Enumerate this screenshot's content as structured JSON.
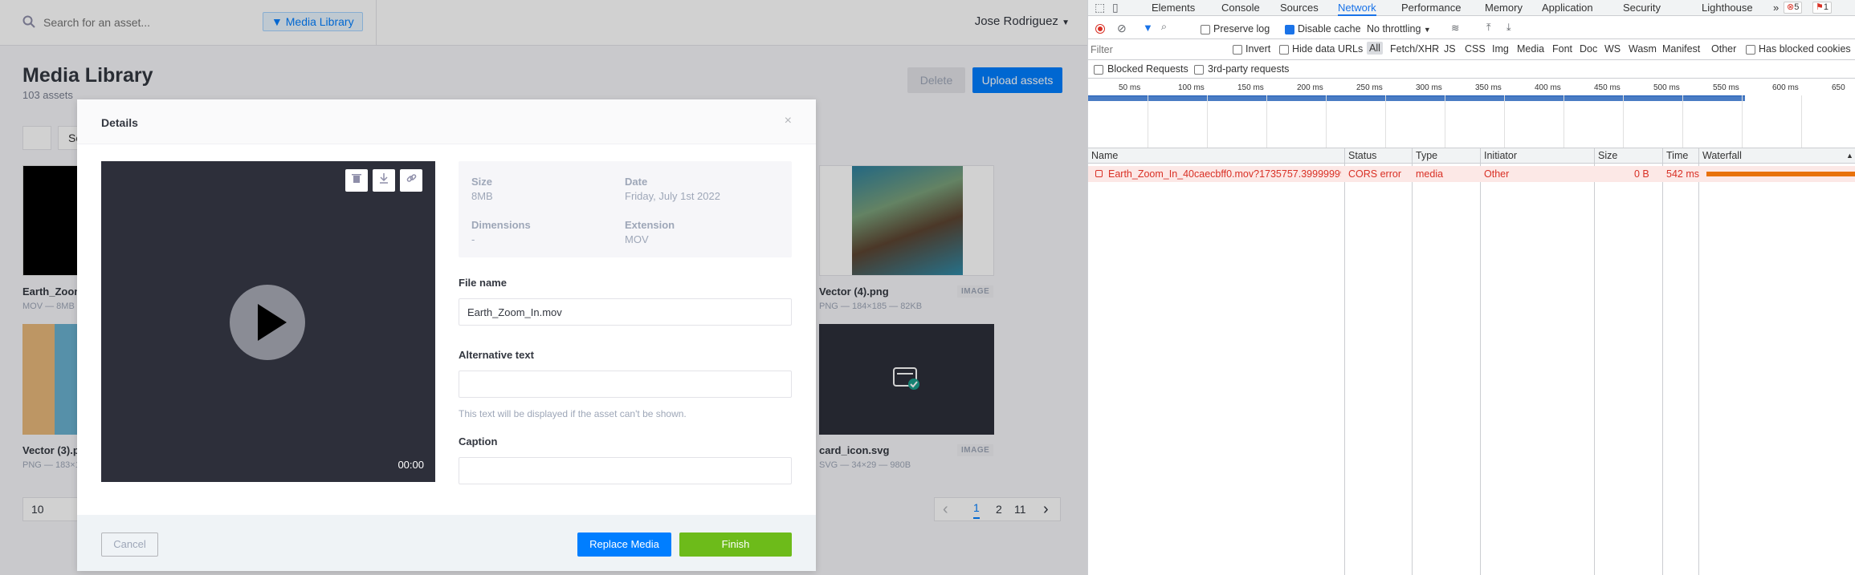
{
  "app": {
    "search": {
      "placeholder": "Search for an asset..."
    },
    "filter_chip": "Media Library",
    "user_name": "Jose Rodriguez",
    "title": "Media Library",
    "subtitle": "103 assets",
    "delete_label": "Delete",
    "upload_label": "Upload assets",
    "sort_partial": "So",
    "cards": [
      {
        "name": "Earth_Zoom",
        "meta": "MOV — 8MB"
      },
      {
        "name": "Vector (3).p",
        "meta": "PNG — 183×1"
      },
      {
        "name": "Vector (4).png",
        "meta": "PNG — 184×185 — 82KB",
        "tag": "IMAGE"
      },
      {
        "name": "card_icon.svg",
        "meta": "SVG — 34×29 — 980B",
        "tag": "IMAGE"
      }
    ],
    "page_size": "10",
    "pages": [
      "1",
      "2",
      "11"
    ],
    "prev": "‹",
    "next": "›"
  },
  "modal": {
    "title": "Details",
    "close": "×",
    "timecode": "00:00",
    "info": {
      "size_label": "Size",
      "size": "8MB",
      "date_label": "Date",
      "date": "Friday, July 1st 2022",
      "dim_label": "Dimensions",
      "dim": "-",
      "ext_label": "Extension",
      "ext": "MOV"
    },
    "file_name_label": "File name",
    "file_name": "Earth_Zoom_In.mov",
    "alt_label": "Alternative text",
    "alt_value": "",
    "alt_hint": "This text will be displayed if the asset can't be shown.",
    "caption_label": "Caption",
    "caption_value": "",
    "cancel": "Cancel",
    "replace": "Replace Media",
    "finish": "Finish"
  },
  "devtools": {
    "tabs": [
      "Elements",
      "Console",
      "Sources",
      "Network",
      "Performance",
      "Memory",
      "Application",
      "Security",
      "Lighthouse"
    ],
    "active_tab": "Network",
    "more": "»",
    "error_count": "5",
    "issue_count": "1",
    "preserve_log": "Preserve log",
    "disable_cache": "Disable cache",
    "throttling": "No throttling",
    "filter_placeholder": "Filter",
    "invert": "Invert",
    "hide_data_urls": "Hide data URLs",
    "types": [
      "All",
      "Fetch/XHR",
      "JS",
      "CSS",
      "Img",
      "Media",
      "Font",
      "Doc",
      "WS",
      "Wasm",
      "Manifest",
      "Other"
    ],
    "has_blocked_cookies": "Has blocked cookies",
    "blocked_requests": "Blocked Requests",
    "third_party": "3rd-party requests",
    "timeline_ticks": [
      "50 ms",
      "100 ms",
      "150 ms",
      "200 ms",
      "250 ms",
      "300 ms",
      "350 ms",
      "400 ms",
      "450 ms",
      "500 ms",
      "550 ms",
      "600 ms",
      "650"
    ],
    "columns": [
      "Name",
      "Status",
      "Type",
      "Initiator",
      "Size",
      "Time",
      "Waterfall"
    ],
    "row": {
      "name": "Earth_Zoom_In_40caecbff0.mov?1735757.39999999...",
      "status": "CORS error",
      "type": "media",
      "initiator": "Other",
      "size": "0 B",
      "time": "542 ms"
    },
    "colors": {
      "error_row": "#fce8e6",
      "error_text": "#d93025",
      "accent": "#1a73e8"
    }
  }
}
